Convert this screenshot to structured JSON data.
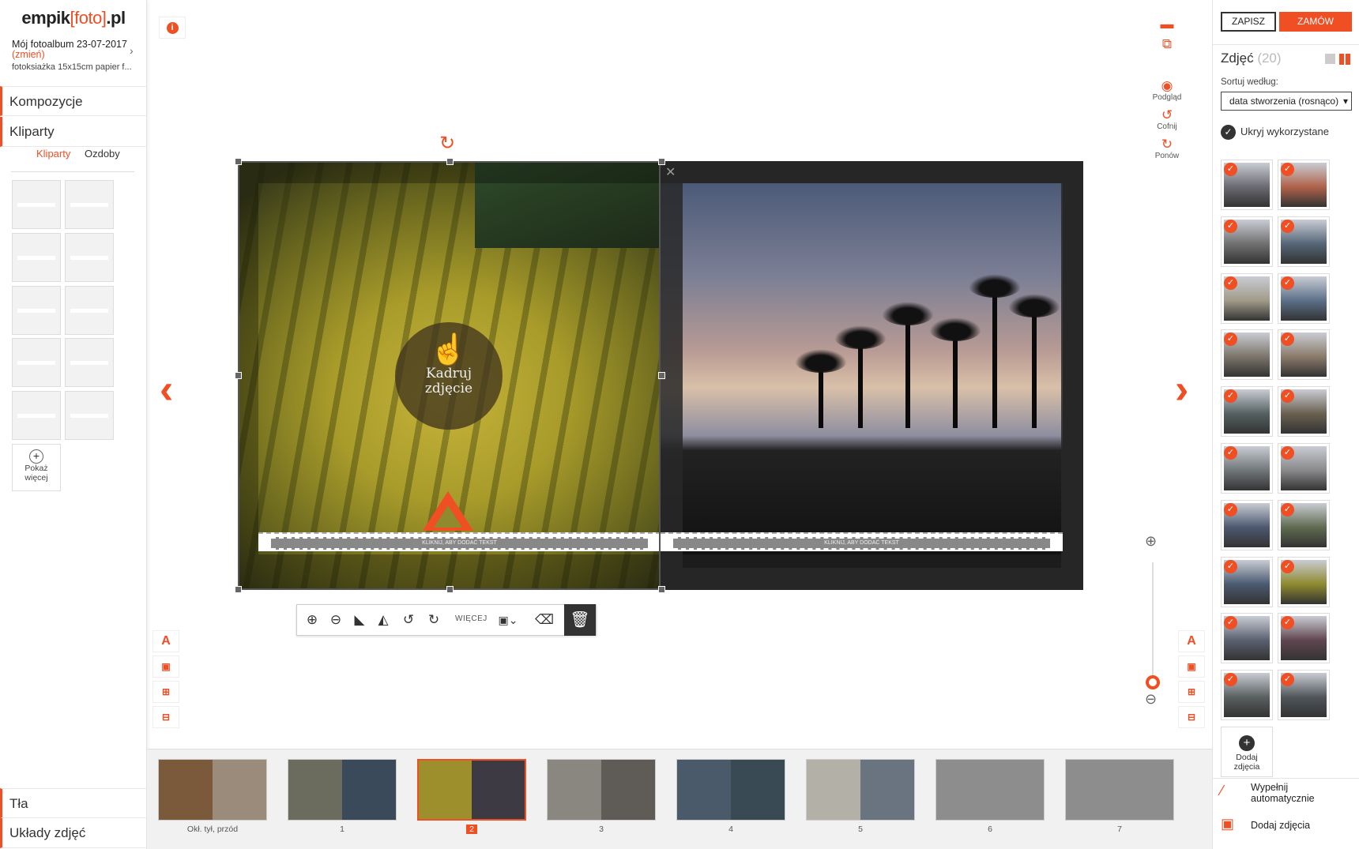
{
  "logo": {
    "pre": "empik",
    "mid": "[foto]",
    "post": ".pl"
  },
  "album": {
    "title": "Mój fotoalbum 23-07-2017",
    "change": "(zmień)",
    "subtitle": "fotoksiażka 15x15cm papier f..."
  },
  "left_nav": {
    "kompozycje": "Kompozycje",
    "kliparty": "Kliparty",
    "tla": "Tła",
    "uklady": "Układy zdjęć"
  },
  "subtabs": {
    "kliparty": "Kliparty",
    "ozdoby": "Ozdoby"
  },
  "more": {
    "label_1": "Pokaż",
    "label_2": "więcej"
  },
  "canvas": {
    "crop_label_1": "Kadruj",
    "crop_label_2": "zdjęcie",
    "text_placeholder": "KLIKNIJ, ABY DODAĆ TEKST"
  },
  "photo_toolbar": {
    "more": "WIĘCEJ"
  },
  "right_tools": {
    "preview": "Podgląd",
    "undo": "Cofnij",
    "redo": "Ponów"
  },
  "filmstrip": [
    {
      "label": "Okł. tył, przód",
      "l": "#7a5a3a",
      "r": "#9a8b7a"
    },
    {
      "label": "1",
      "l": "#6b6b5e",
      "r": "#3b4a5a"
    },
    {
      "label": "2",
      "l": "#9c8f2c",
      "r": "#3d3a44",
      "selected": true
    },
    {
      "label": "3",
      "l": "#8a8680",
      "r": "#5f5c58"
    },
    {
      "label": "4",
      "l": "#4a5a6a",
      "r": "#3a4a55"
    },
    {
      "label": "5",
      "l": "#b3b0a8",
      "r": "#6a7480"
    },
    {
      "label": "6",
      "l": "#8d8d8d",
      "r": "#8d8d8d"
    },
    {
      "label": "7",
      "l": "#8d8d8d",
      "r": "#8d8d8d"
    }
  ],
  "right": {
    "save": "ZAPISZ",
    "order": "ZAMÓW",
    "photos_title": "Zdjęć",
    "photos_count": "(20)",
    "sort_label": "Sortuj według:",
    "sort_value": "data stworzenia (rosnąco)",
    "hide_used": "Ukryj wykorzystane",
    "add_photo_1": "Dodaj",
    "add_photo_2": "zdjęcia",
    "autofill_1": "Wypełnij",
    "autofill_2": "automatycznie",
    "add_photos": "Dodaj zdjęcia",
    "photos": [
      "#6a6a70",
      "#b0624a",
      "#707070",
      "#556677",
      "#a09a88",
      "#5b6f88",
      "#7a746a",
      "#8a7a6a",
      "#556060",
      "#6a6050",
      "#707578",
      "#88888a",
      "#4d5870",
      "#5e6b50",
      "#4a5a70",
      "#8e8a2e",
      "#5a6070",
      "#604650",
      "#5a5f60",
      "#50555a"
    ]
  }
}
